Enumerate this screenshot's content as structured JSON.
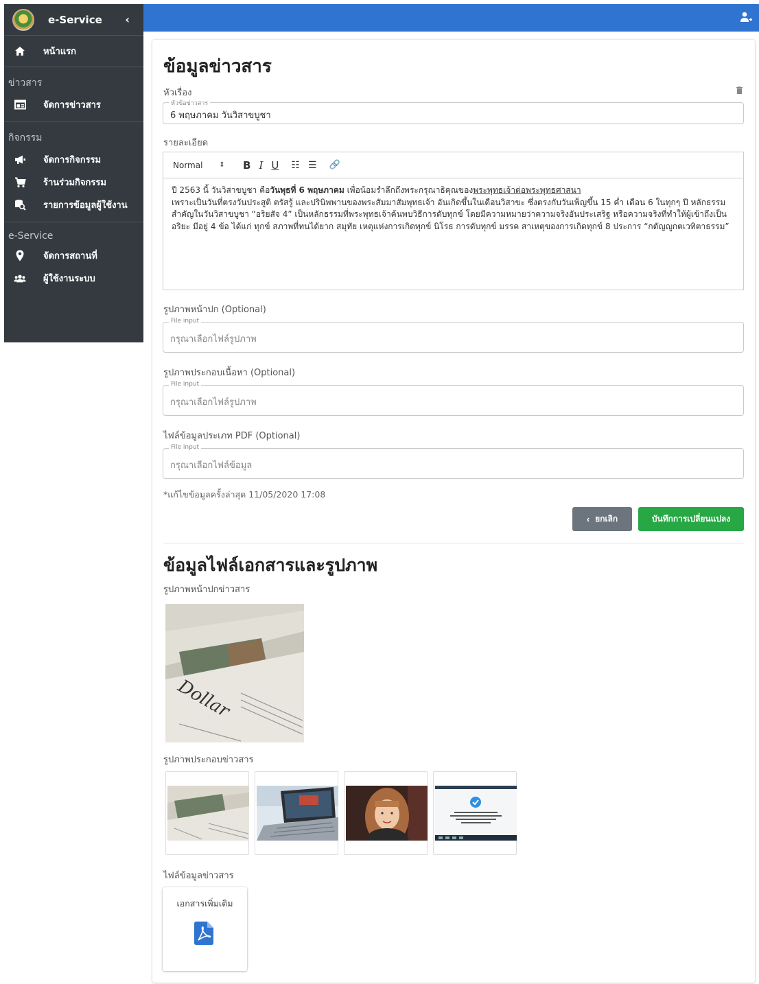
{
  "sidebar": {
    "brand": "e-Service",
    "collapse_glyph": "‹",
    "home": "หน้าแรก",
    "sections": {
      "news": "ข่าวสาร",
      "activity": "กิจกรรม",
      "eservice": "e-Service"
    },
    "items": {
      "manage_news": "จัดการข่าวสาร",
      "manage_activity": "จัดการกิจกรรม",
      "shop_activity": "ร้านร่วมกิจกรรม",
      "user_data": "รายการข้อมูลผู้ใช้งาน",
      "manage_place": "จัดการสถานที่",
      "system_users": "ผู้ใช้งานระบบ"
    }
  },
  "page": {
    "title": "ข้อมูลข่าวสาร",
    "subject_label": "หัวเรื่อง",
    "subject_legend": "หัวข้อข่าวสาร",
    "subject_value": "6 พฤษภาคม วันวิสาขบูชา",
    "detail_label": "รายละเอียด",
    "editor": {
      "format": "Normal",
      "format_arrow": "⇕",
      "bold": "B",
      "italic": "I",
      "underline": "U",
      "ordered_list": "☷",
      "bullet_list": "☰",
      "link": "🔗",
      "p1_a": "ปี 2563 นี้ วันวิสาขบูชา คือ",
      "p1_b": "วันพุธที่ 6 พฤษภาคม",
      "p1_c": " เพื่อน้อมรำลึกถึงพระกรุณาธิคุณของ",
      "p1_d": "พระพุทธเจ้าต่อพระพุทธศาสนา",
      "p2": "เพราะเป็นวันที่ตรงวันประสูติ ตรัสรู้ และปรินิพพานของพระสัมมาสัมพุทธเจ้า อันเกิดขึ้นในเดือนวิสาขะ ซึ่งตรงกับวันเพ็ญขึ้น 15 ค่ำ เดือน 6 ในทุกๆ ปี หลักธรรมสำคัญในวันวิสาขบูชา “อริยสัจ 4” เป็นหลักธรรมที่พระพุทธเจ้าค้นพบวิธีการดับทุกข์ โดยมีความหมายว่าความจริงอันประเสริฐ หรือความจริงที่ทำให้ผู้เข้าถึงเป็นอริยะ มีอยู่ 4 ข้อ ได้แก่ ทุกข์ สภาพที่ทนได้ยาก สมุทัย เหตุแห่งการเกิดทุกข์ นิโรธ การดับทุกข์ มรรค สาเหตุของการเกิดทุกข์ 8 ประการ “กตัญญูกตเวทิตาธรรม”"
    },
    "cover_label": "รูปภาพหน้าปก (Optional)",
    "file_legend": "File input",
    "cover_placeholder": "กรุณาเลือกไฟล์รูปภาพ",
    "content_img_label": "รูปภาพประกอบเนื้อหา (Optional)",
    "content_img_placeholder": "กรุณาเลือกไฟล์รูปภาพ",
    "pdf_label": "ไฟล์ข้อมูลประเภท PDF (Optional)",
    "pdf_placeholder": "กรุณาเลือกไฟล์ข้อมูล",
    "last_edit": "*แก้ไขข้อมูลครั้งล่าสุด 11/05/2020 17:08",
    "cancel_button": "ยกเลิก",
    "save_button": "บันทึกการเปลี่ยนแปลง",
    "files_title": "ข้อมูลไฟล์เอกสารและรูปภาพ",
    "cover_img_heading": "รูปภาพหน้าปกข่าวสาร",
    "gallery_heading": "รูปภาพประกอบข่าวสาร",
    "attachments_heading": "ไฟล์ข้อมูลข่าวสาร",
    "attachment_name": "เอกสารเพิ่มเติม"
  },
  "colors": {
    "sidebar_bg": "#343a40",
    "topbar": "#2f74d0",
    "save": "#28a745",
    "cancel": "#6c757d",
    "pdf": "#2f74d0"
  },
  "icons": [
    "home-icon",
    "newspaper-icon",
    "megaphone-icon",
    "cart-icon",
    "search-database-icon",
    "map-pin-icon",
    "users-icon",
    "user-icon",
    "trash-icon",
    "chevron-left-icon",
    "pdf-icon"
  ]
}
